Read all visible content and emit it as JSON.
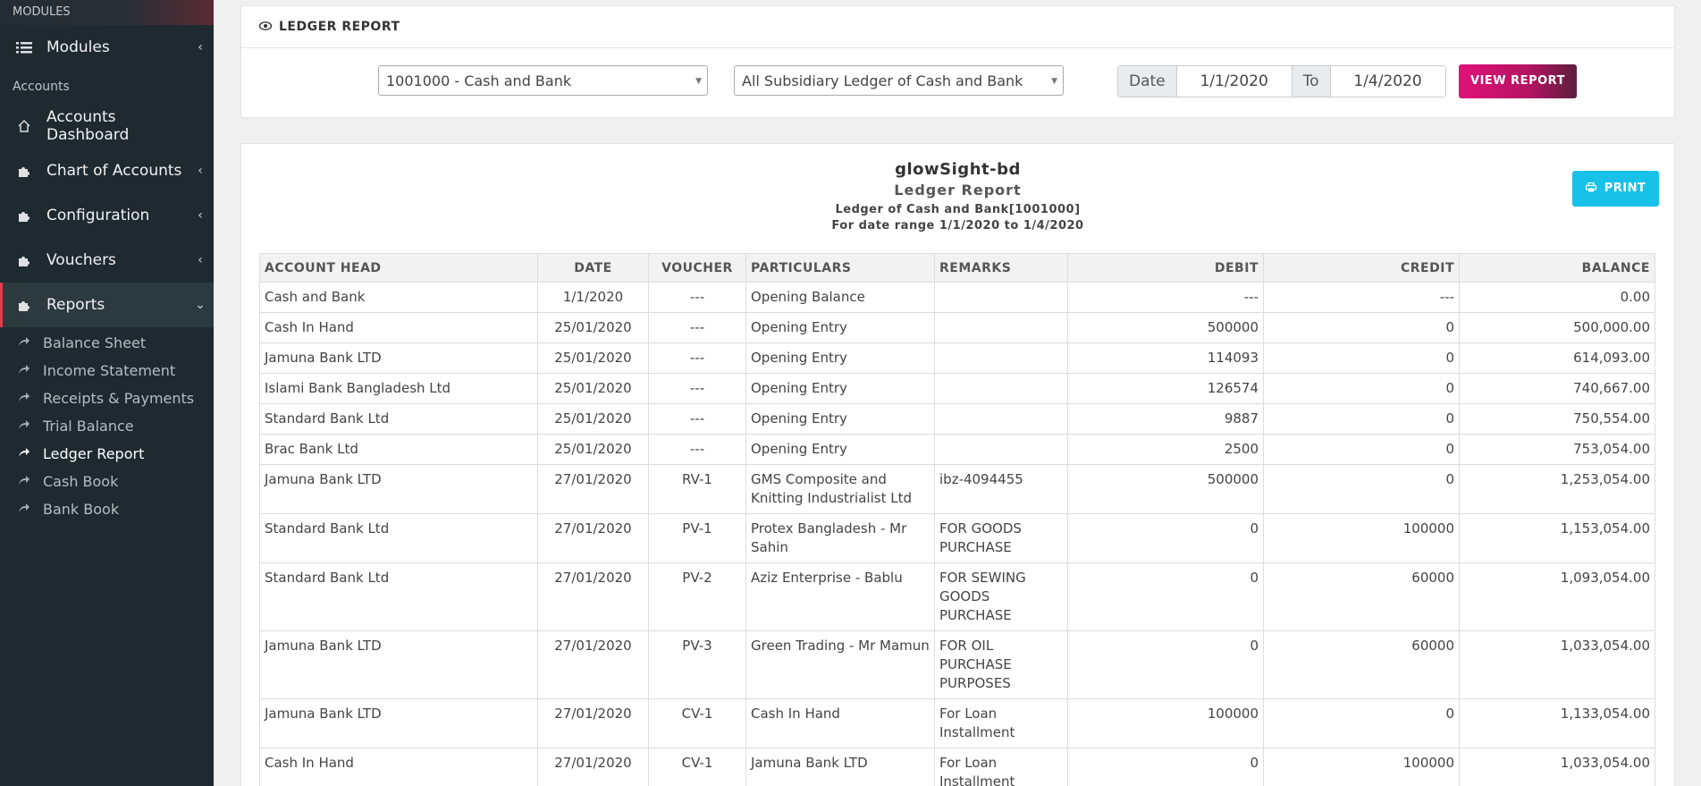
{
  "sidebar": {
    "top_label": "MODULES",
    "modules_label": "Modules",
    "section_label": "Accounts",
    "items": [
      {
        "label": "Accounts Dashboard",
        "icon": "home-icon",
        "chevron": ""
      },
      {
        "label": "Chart of Accounts",
        "icon": "puzzle-icon",
        "chevron": "‹"
      },
      {
        "label": "Configuration",
        "icon": "puzzle-icon",
        "chevron": "‹"
      },
      {
        "label": "Vouchers",
        "icon": "puzzle-icon",
        "chevron": "‹"
      },
      {
        "label": "Reports",
        "icon": "puzzle-icon",
        "chevron": "⌄"
      }
    ],
    "sub_items": [
      {
        "label": "Balance Sheet"
      },
      {
        "label": "Income Statement"
      },
      {
        "label": "Receipts & Payments"
      },
      {
        "label": "Trial Balance"
      },
      {
        "label": "Ledger Report"
      },
      {
        "label": "Cash Book"
      },
      {
        "label": "Bank Book"
      }
    ],
    "active_item": "Reports",
    "current_sub_item": "Ledger Report"
  },
  "filter_panel": {
    "title": "LEDGER REPORT",
    "ledger_select": "1001000 - Cash and Bank",
    "subsidiary_select": "All Subsidiary Ledger of Cash and Bank",
    "date_label": "Date",
    "date_from": "1/1/2020",
    "to_label": "To",
    "date_to": "1/4/2020",
    "view_button": "VIEW REPORT"
  },
  "report": {
    "company": "glowSight-bd",
    "title": "Ledger Report",
    "subtitle": "Ledger of Cash and Bank[1001000]",
    "range": "For date range 1/1/2020 to 1/4/2020",
    "print_button": "PRINT",
    "columns": [
      "ACCOUNT HEAD",
      "DATE",
      "VOUCHER",
      "PARTICULARS",
      "REMARKS",
      "DEBIT",
      "CREDIT",
      "BALANCE"
    ],
    "rows": [
      [
        "Cash and Bank",
        "1/1/2020",
        "---",
        "Opening Balance",
        "",
        "---",
        "---",
        "0.00"
      ],
      [
        "Cash In Hand",
        "25/01/2020",
        "---",
        "Opening Entry",
        "",
        "500000",
        "0",
        "500,000.00"
      ],
      [
        "Jamuna Bank LTD",
        "25/01/2020",
        "---",
        "Opening Entry",
        "",
        "114093",
        "0",
        "614,093.00"
      ],
      [
        "Islami Bank Bangladesh Ltd",
        "25/01/2020",
        "---",
        "Opening Entry",
        "",
        "126574",
        "0",
        "740,667.00"
      ],
      [
        "Standard Bank Ltd",
        "25/01/2020",
        "---",
        "Opening Entry",
        "",
        "9887",
        "0",
        "750,554.00"
      ],
      [
        "Brac Bank Ltd",
        "25/01/2020",
        "---",
        "Opening Entry",
        "",
        "2500",
        "0",
        "753,054.00"
      ],
      [
        "Jamuna Bank LTD",
        "27/01/2020",
        "RV-1",
        "GMS Composite and Knitting Industrialist Ltd",
        "ibz-4094455",
        "500000",
        "0",
        "1,253,054.00"
      ],
      [
        "Standard Bank Ltd",
        "27/01/2020",
        "PV-1",
        "Protex Bangladesh - Mr Sahin",
        "FOR GOODS PURCHASE",
        "0",
        "100000",
        "1,153,054.00"
      ],
      [
        "Standard Bank Ltd",
        "27/01/2020",
        "PV-2",
        "Aziz Enterprise - Bablu",
        "FOR SEWING GOODS PURCHASE",
        "0",
        "60000",
        "1,093,054.00"
      ],
      [
        "Jamuna Bank LTD",
        "27/01/2020",
        "PV-3",
        "Green Trading - Mr Mamun",
        "FOR OIL PURCHASE PURPOSES",
        "0",
        "60000",
        "1,033,054.00"
      ],
      [
        "Jamuna Bank LTD",
        "27/01/2020",
        "CV-1",
        "Cash In Hand",
        "For Loan Installment",
        "100000",
        "0",
        "1,133,054.00"
      ],
      [
        "Cash In Hand",
        "27/01/2020",
        "CV-1",
        "Jamuna Bank LTD",
        "For Loan Installment",
        "0",
        "100000",
        "1,033,054.00"
      ]
    ]
  }
}
